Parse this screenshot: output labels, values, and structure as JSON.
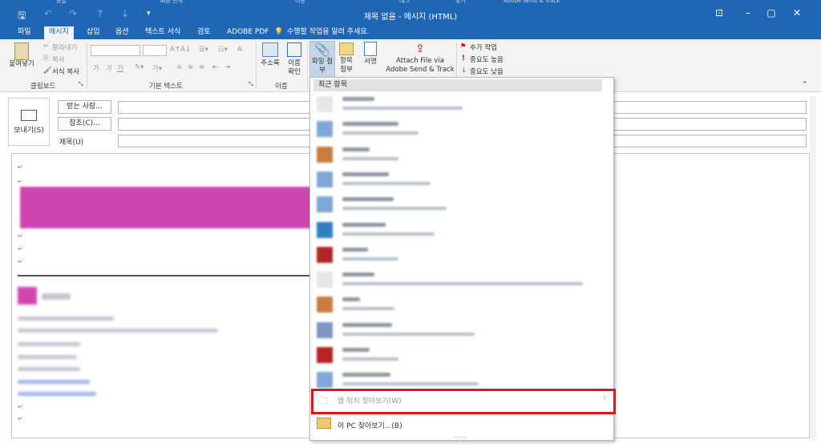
{
  "window": {
    "title": "제목 없음 - 메시지 (HTML)",
    "ghost_labels": [
      "응답",
      "빠른 단계",
      "이동",
      "태그",
      "찾기",
      "Adobe Send & Track"
    ]
  },
  "tabs": [
    {
      "label": "파일",
      "active": false
    },
    {
      "label": "메시지",
      "active": true
    },
    {
      "label": "삽입",
      "active": false
    },
    {
      "label": "옵션",
      "active": false
    },
    {
      "label": "텍스트 서식",
      "active": false
    },
    {
      "label": "검토",
      "active": false
    },
    {
      "label": "ADOBE PDF",
      "active": false
    },
    {
      "label": "수행할 작업을 알려 주세요.",
      "active": false
    }
  ],
  "ribbon": {
    "clipboard": {
      "paste": "붙여넣기",
      "cut": "잘라내기",
      "copy": "복사",
      "format_painter": "서식 복사",
      "group": "클립보드"
    },
    "basic_text": {
      "group": "기본 텍스트"
    },
    "names": {
      "address_book": "주소록",
      "check_names_1": "이름",
      "check_names_2": "확인",
      "group": "이름"
    },
    "include": {
      "attach_file_1": "파일 첨",
      "attach_file_2": "부",
      "attach_item_1": "항목",
      "attach_item_2": "첨부",
      "signature": "서명"
    },
    "adobe": {
      "line1": "Attach File via",
      "line2": "Adobe Send & Track"
    },
    "tags": {
      "follow_up": "추가 작업",
      "high": "중요도 높음",
      "low": "중요도 낮음"
    }
  },
  "compose": {
    "send": "보내기(S)",
    "to": "받는 사람...",
    "cc": "참조(C)...",
    "subject": "제목(U)"
  },
  "dropdown": {
    "header": "최근 항목",
    "items_count": 12,
    "web_browse": "웹 위치 찾아보기(W)",
    "pc_browse": "이 PC 찾아보기...(B)"
  }
}
